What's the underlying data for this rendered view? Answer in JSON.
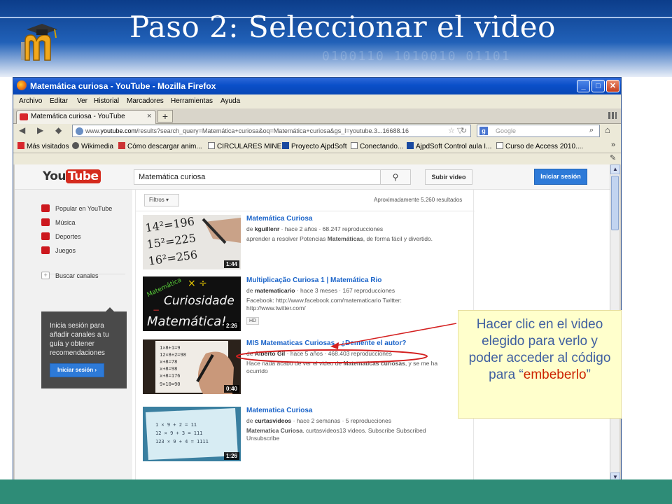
{
  "slide": {
    "title": "Paso 2: Seleccionar el video",
    "accent_color": "#2e8c77",
    "header_color": "#1a4fa0"
  },
  "window": {
    "title": "Matemática curiosa - YouTube - Mozilla Firefox",
    "buttons": {
      "minimize": "_",
      "maximize": "□",
      "close": "✕"
    },
    "menu": [
      "Archivo",
      "Editar",
      "Ver",
      "Historial",
      "Marcadores",
      "Herramientas",
      "Ayuda"
    ],
    "tab": {
      "label": "Matemática curiosa - YouTube",
      "close": "×",
      "new": "+"
    },
    "url_prefix": "www.",
    "url_domain": "youtube.com",
    "url_rest": "/results?search_query=Matemática+curiosa&oq=Matemática+curiosa&gs_l=youtube.3...16688.16",
    "search_placeholder": "Google",
    "bookmarks": [
      "Más visitados",
      "Wikimedia",
      "Cómo descargar anim...",
      "CIRCULARES MINED",
      "Proyecto AjpdSoft",
      "Conectando...",
      "AjpdSoft Control aula I...",
      "Curso de Access 2010...."
    ]
  },
  "youtube": {
    "logo_you": "You",
    "logo_tube": "Tube",
    "search_value": "Matemática curiosa",
    "upload_label": "Subir video",
    "signin_label": "Iniciar sesión",
    "sidebar": {
      "items": [
        "Popular en YouTube",
        "Música",
        "Deportes",
        "Juegos"
      ],
      "browse_channels": "Buscar canales",
      "card_text": "Inicia sesión para añadir canales a tu guía y obtener recomendaciones",
      "card_button": "Iniciar sesión ›"
    },
    "filters_label": "Filtros",
    "result_count": "Aproximadamente 5.260 resultados",
    "results": [
      {
        "title": "Matemática Curiosa",
        "channel": "kguillenr",
        "meta": " · hace 2 años · 68.247 reproducciones",
        "desc_a": "aprender a resolver Potencias ",
        "desc_b": "Matemáticas",
        "desc_c": ", de forma fácil y divertido.",
        "duration": "1:44"
      },
      {
        "title": "Multiplicação Curiosa 1 | Matemática Rio",
        "channel": "matematicario",
        "meta": " · hace 3 meses · 167 reproducciones",
        "desc": "Facebook: http://www.facebook.com/matematicario Twitter: http://www.twitter.com/",
        "badge": "HD",
        "thumb_line1": "Curiosidade",
        "thumb_line2": "Matemática!",
        "thumb_small": "Matemática",
        "duration": "2:26"
      },
      {
        "title": "MIS Matematicas Curiosas - ¿Demente el autor?",
        "channel": "Alberto Gil",
        "meta": " · hace 5 años · 468.403 reproducciones",
        "desc_a": "Hace nada acabo de ver el video de ",
        "desc_b": "Matematicas curiosas",
        "desc_c": ", y se me ha ocurrido",
        "duration": "0:40"
      },
      {
        "title": "Matematica Curiosa",
        "channel": "curtasvideos",
        "meta": " · hace 2 semanas · 5 reproducciones",
        "desc_a": "Matematica Curiosa",
        "desc_b": ". curtasvideos13 videos. Subscribe Subscribed Unsubscribe",
        "duration": "1:26"
      }
    ]
  },
  "callout": {
    "text": "Hacer clic en el video elegido para verlo y poder acceder al código para “",
    "highlight": "embeberlo",
    "text_end": "”"
  }
}
